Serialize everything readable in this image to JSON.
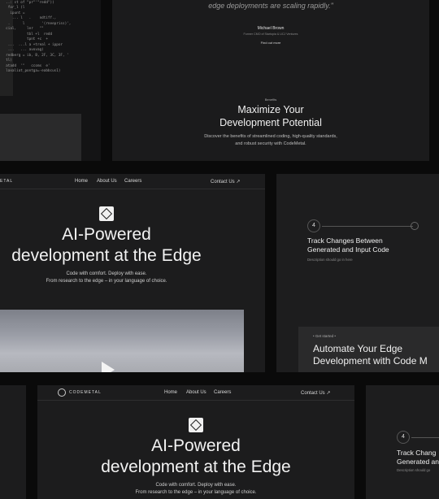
{
  "top_left": {
    "code_lines": [
      "        \"bidi\", \"fp\", \"cp\", \"redd",
      "  ..: st of \"pr\"'\"redd\"))",
      "   for_l (l",
      "    ipunt =",
      "     ... l   .    ndtiff.,",
      "   .      l        '(rneepriss)',",
      "  cial,     ler   \"\"",
      "            tbl +l  redd",
      "            tpnt +c  +",
      "   ...  ...l a +treal + ippor",
      "   ...   ... avovag)",
      "",
      "  redberg = ib, B, 2F, 3C, 3F, '",
      "  tl)",
      "  atadd  '\"   ccoms  e'",
      "  laxaliat_pontga=-eabbcus1)"
    ]
  },
  "testimonial": {
    "quote": "edge deployments are scaling rapidly.\"",
    "author": "Michael Brown",
    "role": "Former CMO of Startopia & UCJ Ventures",
    "link": "Find out more"
  },
  "benefits": {
    "eyebrow": "Benefits",
    "title_line1": "Maximize Your",
    "title_line2": "Development Potential",
    "desc_line1": "Discover the benefits of streamlined coding, high-quality standards,",
    "desc_line2": "and robust security with CodeMetal."
  },
  "hero": {
    "brand_fragment": "ETAL",
    "nav": [
      "Home",
      "About Us",
      "Careers"
    ],
    "contact": "Contact Us ↗",
    "title_line1": "AI-Powered",
    "title_line2": "development at the Edge",
    "sub_line1": "Code with comfort. Deploy with ease.",
    "sub_line2": "From research to the edge – in your language of choice."
  },
  "track": {
    "step": "4",
    "title_line1": "Track Changes Between",
    "title_line2": "Generated and Input Code",
    "desc": "Description should go in here",
    "cta_eyebrow": "• Get started •",
    "cta_line1": "Automate Your Edge",
    "cta_line2": "Development with Code M"
  },
  "bottom": {
    "brand": "CODEMETAL",
    "nav": [
      "Home",
      "About Us",
      "Careers"
    ],
    "contact": "Contact Us ↗",
    "title_line1": "AI-Powered",
    "title_line2": "development at the Edge",
    "sub_line1": "Code with comfort. Deploy with ease.",
    "sub_line2": "From research to the edge – in your language of choice."
  },
  "bottom_right": {
    "step": "4",
    "title_line1": "Track Chang",
    "title_line2": "Generated an",
    "desc": "Description should go"
  }
}
